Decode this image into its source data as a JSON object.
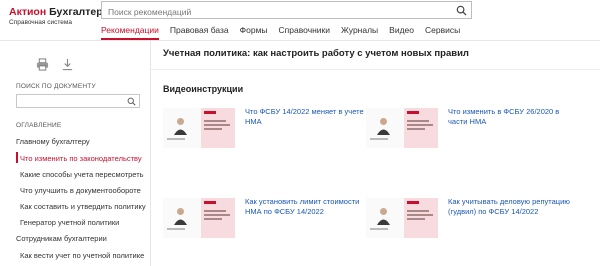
{
  "header": {
    "logo_brand": "Актион",
    "logo_product": "Бухгалтерия",
    "logo_subtitle": "Справочная система",
    "search_placeholder": "Поиск рекомендаций"
  },
  "nav": {
    "tabs": [
      "Рекомендации",
      "Правовая база",
      "Формы",
      "Справочники",
      "Журналы",
      "Видео",
      "Сервисы"
    ],
    "active_index": 0
  },
  "sidebar": {
    "doc_search_label": "ПОИСК ПО ДОКУМЕНТУ",
    "toc_label": "ОГЛАВЛЕНИЕ",
    "toc": [
      {
        "label": "Главному бухгалтеру",
        "level": 1
      },
      {
        "label": "Что изменить по законодательству",
        "level": 2,
        "active": true
      },
      {
        "label": "Какие способы учета пересмотреть",
        "level": 2
      },
      {
        "label": "Что улучшить в документообороте",
        "level": 2
      },
      {
        "label": "Как составить и утвердить политику",
        "level": 2
      },
      {
        "label": "Генератор учетной политики",
        "level": 2
      },
      {
        "label": "Сотрудникам бухгалтерии",
        "level": 1
      },
      {
        "label": "Как вести учет по учетной политике",
        "level": 2
      }
    ]
  },
  "main": {
    "title": "Учетная политика: как настроить работу с учетом новых правил",
    "section_title": "Видеоинструкции",
    "videos": [
      {
        "title": "Что ФСБУ 14/2022 меняет в учете НМА"
      },
      {
        "title": "Что изменить в ФСБУ 26/2020 в части НМА"
      },
      {
        "title": "Как установить лимит стоимости НМА по ФСБУ 14/2022"
      },
      {
        "title": "Как учитывать деловую репутацию (гудвил) по ФСБУ 14/2022"
      }
    ]
  },
  "colors": {
    "accent": "#c8102e",
    "link": "#1a57b8"
  }
}
